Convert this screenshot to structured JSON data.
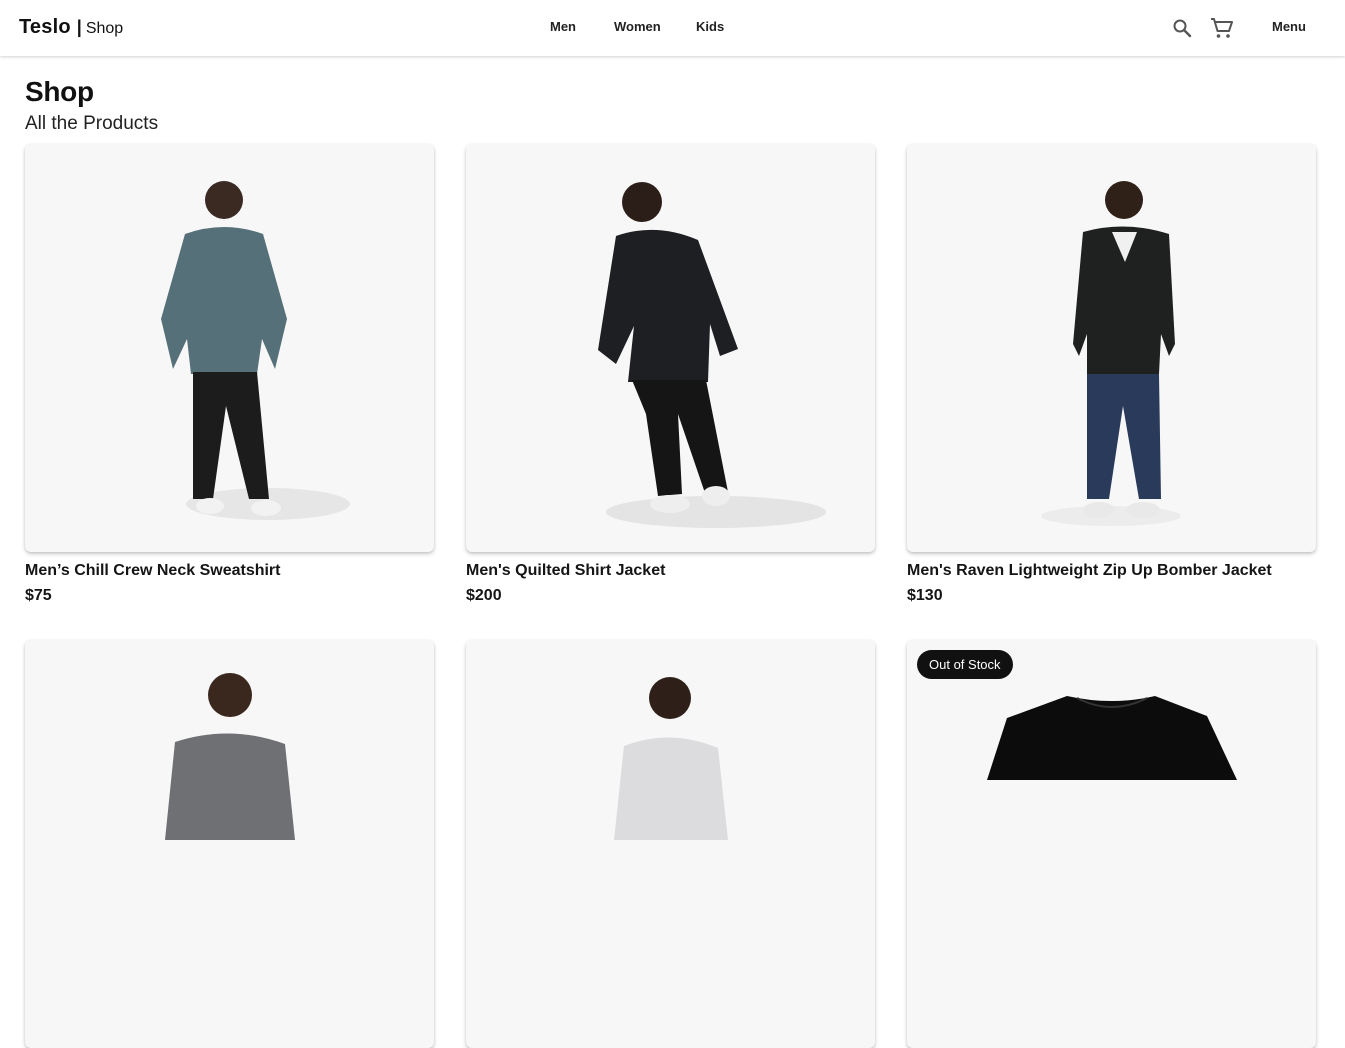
{
  "header": {
    "brand": "Teslo",
    "brand_separator": "|",
    "brand_sub": "Shop",
    "nav": [
      "Men",
      "Women",
      "Kids"
    ],
    "menu_label": "Menu",
    "icons": [
      "search-icon",
      "cart-icon"
    ]
  },
  "page": {
    "title": "Shop",
    "subtitle": "All the Products"
  },
  "products": [
    {
      "name": "Men’s Chill Crew Neck Sweatshirt",
      "price": "$75",
      "top_color": "#56707a",
      "pants_color": "#1c1c1c"
    },
    {
      "name": "Men's Quilted Shirt Jacket",
      "price": "$200",
      "top_color": "#1d1f22",
      "pants_color": "#151515"
    },
    {
      "name": "Men's Raven Lightweight Zip Up Bomber Jacket",
      "price": "$130",
      "top_color": "#1f2120",
      "pants_color": "#2a3a5a"
    },
    {
      "name": "",
      "price": "",
      "top_color": "#6e7073"
    },
    {
      "name": "",
      "price": "",
      "top_color": "#dcdcdf"
    },
    {
      "name": "",
      "price": "",
      "badge": "Out of Stock",
      "top_color": "#0c0c0c"
    }
  ]
}
